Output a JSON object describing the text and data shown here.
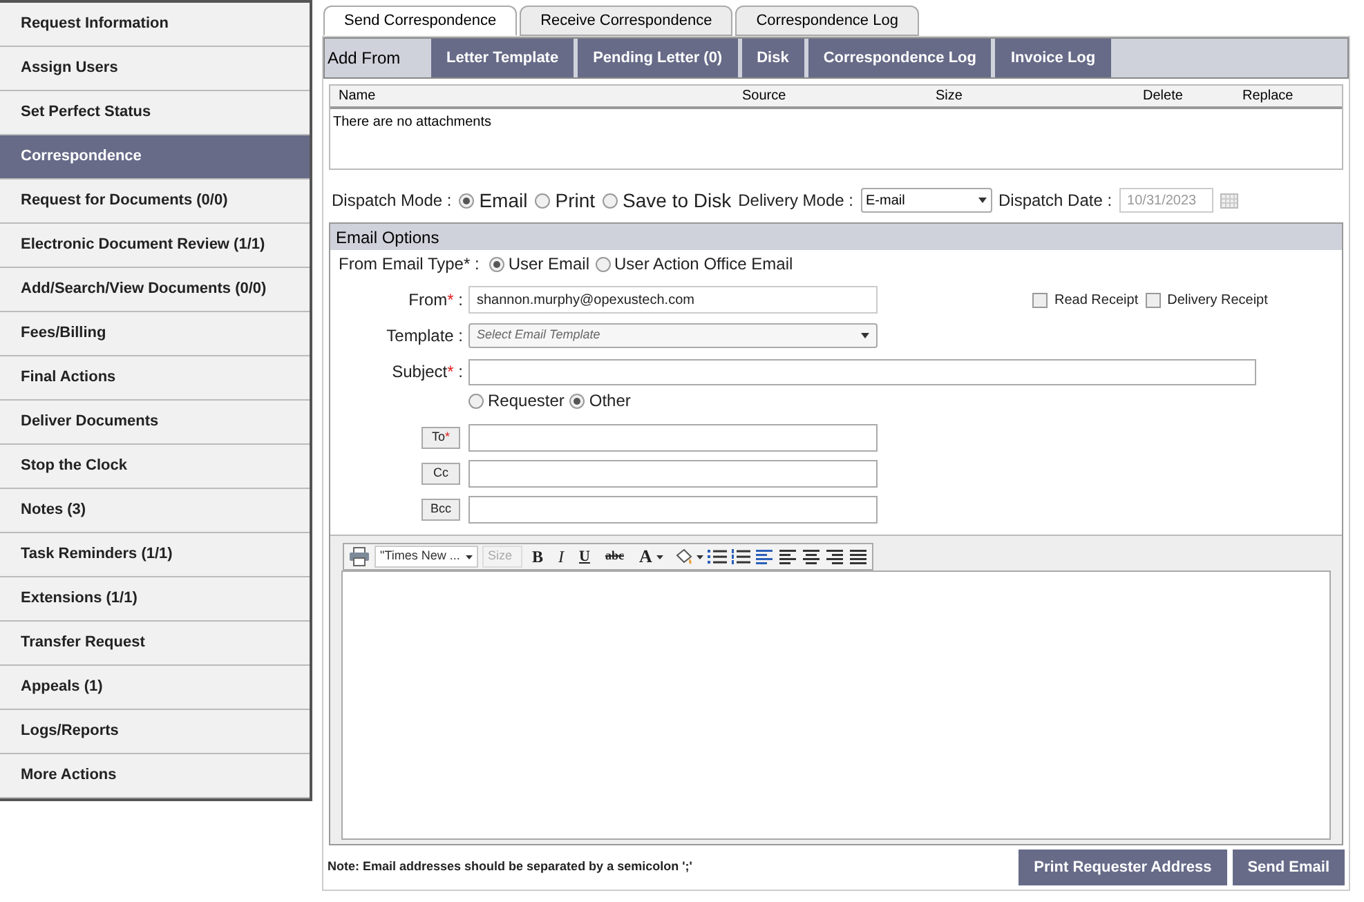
{
  "sidebar": {
    "items": [
      {
        "label": "Request Information",
        "selected": false
      },
      {
        "label": "Assign Users",
        "selected": false
      },
      {
        "label": "Set Perfect Status",
        "selected": false
      },
      {
        "label": "Correspondence",
        "selected": true
      },
      {
        "label": "Request for Documents (0/0)",
        "selected": false
      },
      {
        "label": "Electronic Document Review (1/1)",
        "selected": false
      },
      {
        "label": "Add/Search/View Documents (0/0)",
        "selected": false
      },
      {
        "label": "Fees/Billing",
        "selected": false
      },
      {
        "label": "Final Actions",
        "selected": false
      },
      {
        "label": "Deliver Documents",
        "selected": false
      },
      {
        "label": "Stop the Clock",
        "selected": false
      },
      {
        "label": "Notes (3)",
        "selected": false
      },
      {
        "label": "Task Reminders (1/1)",
        "selected": false
      },
      {
        "label": "Extensions (1/1)",
        "selected": false
      },
      {
        "label": "Transfer Request",
        "selected": false
      },
      {
        "label": "Appeals (1)",
        "selected": false
      },
      {
        "label": "Logs/Reports",
        "selected": false
      },
      {
        "label": "More Actions",
        "selected": false
      }
    ]
  },
  "tabs": [
    {
      "label": "Send Correspondence",
      "selected": true
    },
    {
      "label": "Receive Correspondence",
      "selected": false
    },
    {
      "label": "Correspondence Log",
      "selected": false
    }
  ],
  "add_from": {
    "label": "Add From",
    "buttons": [
      "Letter Template",
      "Pending Letter (0)",
      "Disk",
      "Correspondence Log",
      "Invoice Log"
    ]
  },
  "attachments": {
    "columns": [
      "Name",
      "Source",
      "Size",
      "Delete",
      "Replace"
    ],
    "empty_message": "There are no attachments"
  },
  "dispatch": {
    "label": "Dispatch Mode :",
    "options": [
      {
        "label": "Email",
        "selected": true
      },
      {
        "label": "Print",
        "selected": false
      },
      {
        "label": "Save to Disk",
        "selected": false
      }
    ],
    "delivery_mode": {
      "label": "Delivery Mode :",
      "value": "E-mail"
    },
    "dispatch_date": {
      "label": "Dispatch Date :",
      "value": "10/31/2023"
    }
  },
  "email_options": {
    "title": "Email Options",
    "from_email_type": {
      "label": "From Email Type* :",
      "options": [
        {
          "label": "User Email",
          "selected": true
        },
        {
          "label": "User Action Office Email",
          "selected": false
        }
      ]
    },
    "from": {
      "label": "From",
      "mark": "*",
      "colon": ":",
      "value": "shannon.murphy@opexustech.com"
    },
    "receipts": [
      {
        "label": "Read Receipt",
        "checked": false
      },
      {
        "label": "Delivery Receipt",
        "checked": false
      }
    ],
    "template": {
      "label": "Template :",
      "placeholder": "Select Email Template"
    },
    "subject": {
      "label": "Subject",
      "mark": "*",
      "colon": ":"
    },
    "recipient_type": [
      {
        "label": "Requester",
        "selected": false
      },
      {
        "label": "Other",
        "selected": true
      }
    ],
    "address_fields": [
      {
        "label": "To",
        "mark": "*"
      },
      {
        "label": "Cc"
      },
      {
        "label": "Bcc"
      }
    ]
  },
  "editor": {
    "font": "\"Times New ...",
    "size": "Size",
    "tools": [
      {
        "kind": "print"
      },
      {
        "kind": "bold",
        "label": "B"
      },
      {
        "kind": "italic",
        "label": "I"
      },
      {
        "kind": "underline",
        "label": "U"
      },
      {
        "kind": "strike",
        "label": "abc"
      },
      {
        "kind": "color",
        "label": "A"
      },
      {
        "kind": "fill"
      },
      {
        "kind": "bullets"
      },
      {
        "kind": "numbers"
      },
      {
        "kind": "align-left-blue"
      },
      {
        "kind": "align-left"
      },
      {
        "kind": "align-center"
      },
      {
        "kind": "align-right"
      },
      {
        "kind": "justify"
      }
    ]
  },
  "note": "Note: Email addresses should be separated by a semicolon ';'",
  "buttons": [
    "Print Requester Address",
    "Send Email"
  ]
}
